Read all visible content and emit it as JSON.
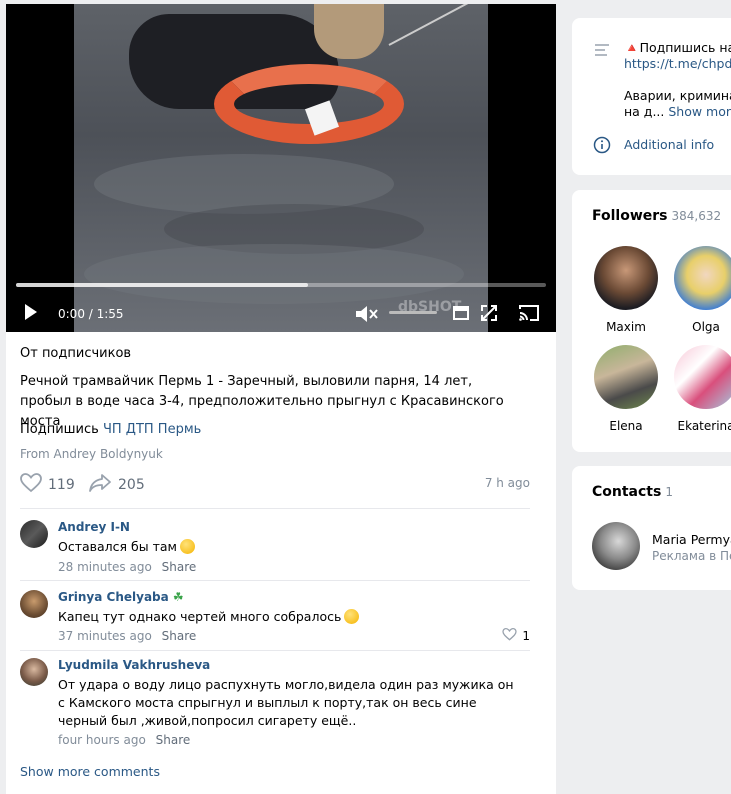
{
  "video": {
    "time": "0:00 / 1:55",
    "progress": 0.55,
    "watermark": "dbSHOT"
  },
  "post": {
    "source": "От подписчиков",
    "text": "Речной трамвайчик Пермь 1 - Заречный, выловили парня, 14 лет, пробыл в воде часа 3-4, предположительно прыгнул с Красавинского моста",
    "subscribe_prefix": "Подпишись",
    "subscribe_link": "ЧП ДТП Пермь",
    "from": "From Andrey Boldynyuk",
    "likes": "119",
    "shares": "205",
    "time_ago": "7 h ago"
  },
  "comments": [
    {
      "author": "Andrey I-N",
      "text": "Оставался бы там",
      "time": "28 minutes ago",
      "share": "Share",
      "likes": ""
    },
    {
      "author": "Grinya Chelyaba",
      "text": "Капец тут однако чертей много собралось",
      "time": "37 minutes ago",
      "share": "Share",
      "likes": "1"
    },
    {
      "author": "Lyudmila Vakhrusheva",
      "text": "От удара о воду лицо распухнуть могло,видела один раз мужика он с Камского моста спрыгнул и выплыл к порту,так он весь сине черный был ,живой,попросил сигарету ещё..",
      "time": "four hours ago",
      "share": "Share",
      "likes": ""
    }
  ],
  "show_more_comments": "Show more comments",
  "about": {
    "line1": "🔺Подпишись на",
    "link": "https://t.me/chpdtp",
    "line3": "Аварии, кримина",
    "line4_prefix": "на д...",
    "show_more": "Show more",
    "additional_info": "Additional info"
  },
  "followers": {
    "title": "Followers",
    "count": "384,632",
    "items": [
      {
        "name": "Maxim"
      },
      {
        "name": "Olga"
      },
      {
        "name": "Elena"
      },
      {
        "name": "Ekaterina"
      }
    ]
  },
  "contacts": {
    "title": "Contacts",
    "count": "1",
    "name": "Maria Permya",
    "subtitle": "Реклама в Пе"
  },
  "colors": {
    "link": "#2a5885",
    "muted": "#818c99",
    "background": "#edeef0"
  }
}
